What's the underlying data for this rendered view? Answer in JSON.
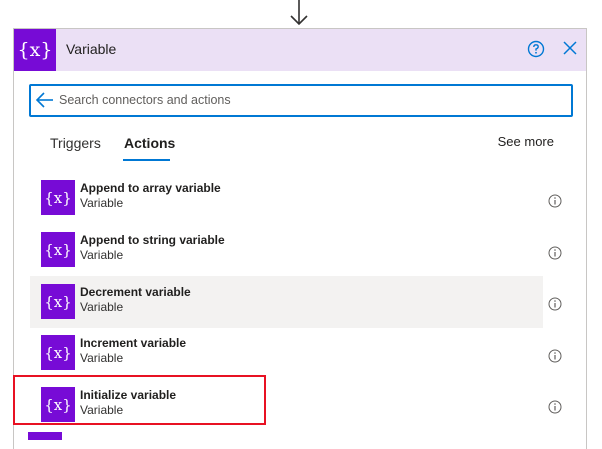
{
  "header": {
    "icon_text": "{x}",
    "title": "Variable"
  },
  "search": {
    "value": "",
    "placeholder": "Search connectors and actions"
  },
  "tabs": [
    {
      "label": "Triggers",
      "active": false
    },
    {
      "label": "Actions",
      "active": true
    }
  ],
  "see_more": "See more",
  "actions": [
    {
      "title": "Append to array variable",
      "subtitle": "Variable",
      "icon_text": "{x}"
    },
    {
      "title": "Append to string variable",
      "subtitle": "Variable",
      "icon_text": "{x}"
    },
    {
      "title": "Decrement variable",
      "subtitle": "Variable",
      "icon_text": "{x}"
    },
    {
      "title": "Increment variable",
      "subtitle": "Variable",
      "icon_text": "{x}"
    },
    {
      "title": "Initialize variable",
      "subtitle": "Variable",
      "icon_text": "{x}"
    }
  ],
  "colors": {
    "brand": "#770bd6",
    "header_bg": "#ebe0f5",
    "accent": "#0078d4",
    "highlight": "#e81123"
  },
  "icons": {
    "flow": "down-arrow-icon",
    "help": "help-circle-icon",
    "close": "close-icon",
    "back": "back-arrow-icon",
    "info": "info-icon"
  }
}
